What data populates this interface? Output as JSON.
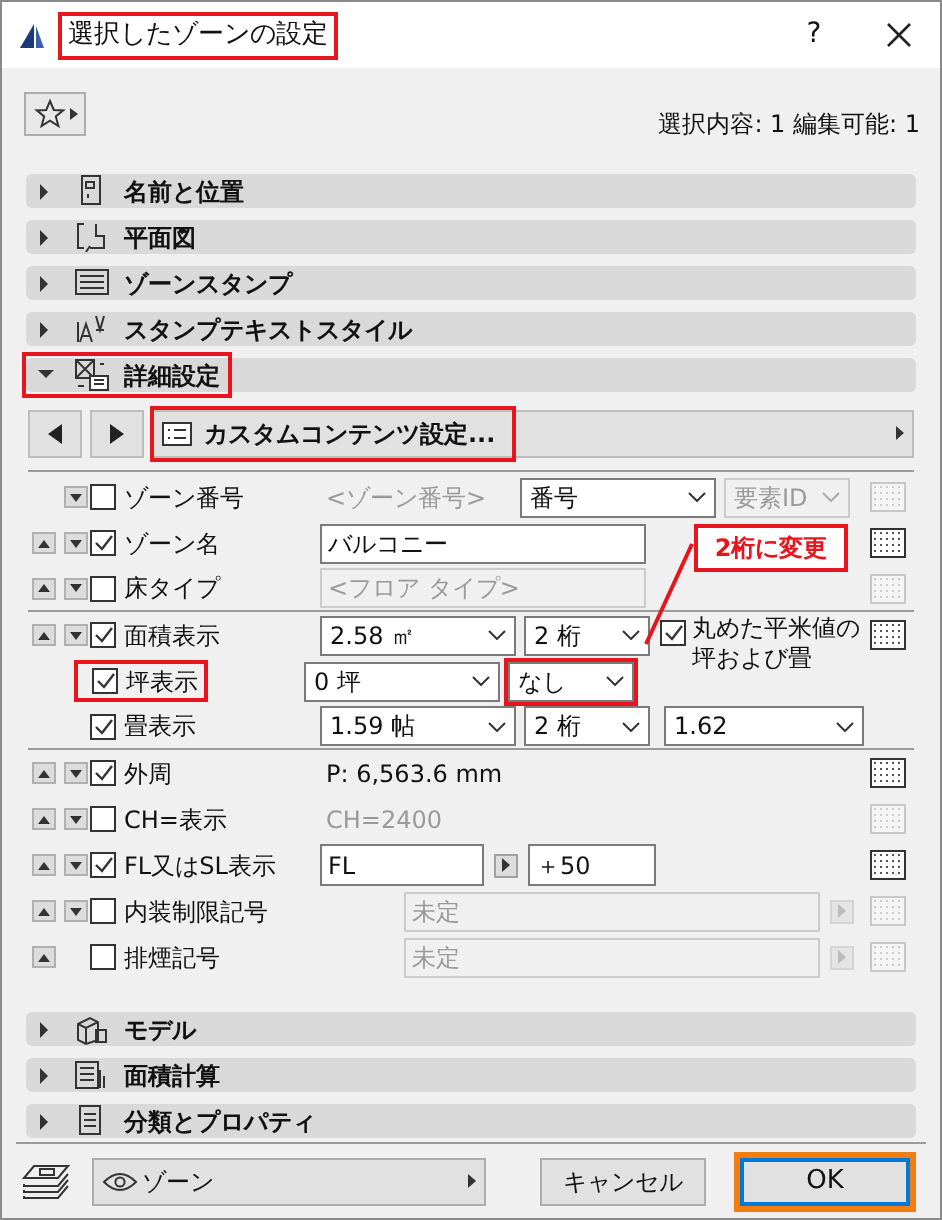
{
  "window": {
    "title": "選択したゾーンの設定",
    "title_marked": true,
    "help": "?"
  },
  "selection_info": "選択内容: 1 編集可能: 1",
  "sections_top": [
    {
      "kind": "door",
      "label": "名前と位置",
      "expanded": false,
      "marked": false
    },
    {
      "kind": "plan",
      "label": "平面図",
      "expanded": false,
      "marked": false
    },
    {
      "kind": "stamp",
      "label": "ゾーンスタンプ",
      "expanded": false,
      "marked": false
    },
    {
      "kind": "text_style",
      "label": "スタンプテキストスタイル",
      "expanded": false,
      "marked": false
    },
    {
      "kind": "detail",
      "label": "詳細設定",
      "expanded": true,
      "marked": true
    }
  ],
  "nav": {
    "label": "カスタムコンテンツ設定...",
    "marked": true
  },
  "rows": [
    {
      "up": false,
      "down": true,
      "checked": false,
      "label": "ゾーン番号",
      "marked": false,
      "pattern_button": true,
      "pattern_enabled": false,
      "divider": false,
      "controls": [
        {
          "kind": "text",
          "value": "<ゾーン番号>",
          "disabled": true
        },
        {
          "kind": "select",
          "value": "番号",
          "disabled": false
        },
        {
          "kind": "select",
          "value": "要素ID",
          "disabled": true
        }
      ]
    },
    {
      "up": true,
      "down": true,
      "checked": true,
      "label": "ゾーン名",
      "marked": false,
      "pattern_button": true,
      "pattern_enabled": true,
      "divider": false,
      "controls": [
        {
          "kind": "field",
          "value": "バルコニー",
          "disabled": false
        }
      ]
    },
    {
      "up": true,
      "down": true,
      "checked": false,
      "label": "床タイプ",
      "marked": false,
      "pattern_button": true,
      "pattern_enabled": false,
      "divider": true,
      "controls": [
        {
          "kind": "field",
          "placeholder": "<フロア タイプ>",
          "disabled": true
        }
      ]
    },
    {
      "up": true,
      "down": true,
      "checked": true,
      "label": "面積表示",
      "marked": false,
      "pattern_button": true,
      "pattern_enabled": true,
      "divider": false,
      "controls": [
        {
          "kind": "select",
          "value": "2.58 ㎡",
          "disabled": false
        },
        {
          "kind": "select",
          "value": "2 桁",
          "disabled": false
        },
        {
          "kind": "option",
          "value": "丸めた平米値の坪および畳",
          "checked": true
        }
      ]
    },
    {
      "up": false,
      "down": false,
      "checked": true,
      "label": "坪表示",
      "marked": true,
      "pattern_button": false,
      "divider": false,
      "controls": [
        {
          "kind": "select",
          "value": "0 坪",
          "disabled": false
        },
        {
          "kind": "select",
          "value": "なし",
          "marked": true
        }
      ]
    },
    {
      "up": false,
      "down": false,
      "checked": true,
      "label": "畳表示",
      "marked": false,
      "pattern_button": false,
      "divider": true,
      "controls": [
        {
          "kind": "select",
          "value": "1.59 帖",
          "disabled": false
        },
        {
          "kind": "select",
          "value": "2 桁",
          "disabled": false
        },
        {
          "kind": "select",
          "value": "1.62",
          "disabled": false
        }
      ]
    },
    {
      "up": true,
      "down": true,
      "checked": true,
      "label": "外周",
      "marked": false,
      "pattern_button": true,
      "pattern_enabled": true,
      "divider": false,
      "controls": [
        {
          "kind": "text",
          "value": "P: 6,563.6 mm",
          "disabled": false
        }
      ]
    },
    {
      "up": true,
      "down": true,
      "checked": false,
      "label": "CH=表示",
      "marked": false,
      "pattern_button": true,
      "pattern_enabled": false,
      "divider": false,
      "controls": [
        {
          "kind": "text",
          "value": "CH=2400",
          "disabled": true
        }
      ]
    },
    {
      "up": true,
      "down": true,
      "checked": true,
      "label": "FL又はSL表示",
      "marked": false,
      "pattern_button": true,
      "pattern_enabled": true,
      "divider": false,
      "controls": [
        {
          "kind": "short",
          "value": "FL",
          "disabled": false
        },
        {
          "kind": "step",
          "disabled": false
        },
        {
          "kind": "short",
          "value": "＋50",
          "disabled": false
        }
      ]
    },
    {
      "up": true,
      "down": true,
      "checked": false,
      "label": "内装制限記号",
      "marked": false,
      "pattern_button": true,
      "pattern_enabled": false,
      "divider": false,
      "controls": [
        {
          "kind": "wide",
          "value": "未定",
          "disabled": true
        },
        {
          "kind": "step",
          "disabled": true
        }
      ]
    },
    {
      "up": true,
      "down": false,
      "checked": false,
      "label": "排煙記号",
      "marked": false,
      "pattern_button": true,
      "pattern_enabled": false,
      "divider": false,
      "controls": [
        {
          "kind": "wide",
          "value": "未定",
          "disabled": true
        },
        {
          "kind": "step",
          "disabled": true
        }
      ]
    }
  ],
  "annotation": {
    "text": "2桁に変更"
  },
  "sections_bottom": [
    {
      "kind": "model",
      "label": "モデル",
      "expanded": false,
      "marked": false
    },
    {
      "kind": "area",
      "label": "面積計算",
      "expanded": false,
      "marked": false
    },
    {
      "kind": "doc",
      "label": "分類とプロパティ",
      "expanded": false,
      "marked": false
    }
  ],
  "footer": {
    "layer": "ゾーン",
    "cancel": "キャンセル",
    "ok": "OK",
    "ok_focused": true
  }
}
